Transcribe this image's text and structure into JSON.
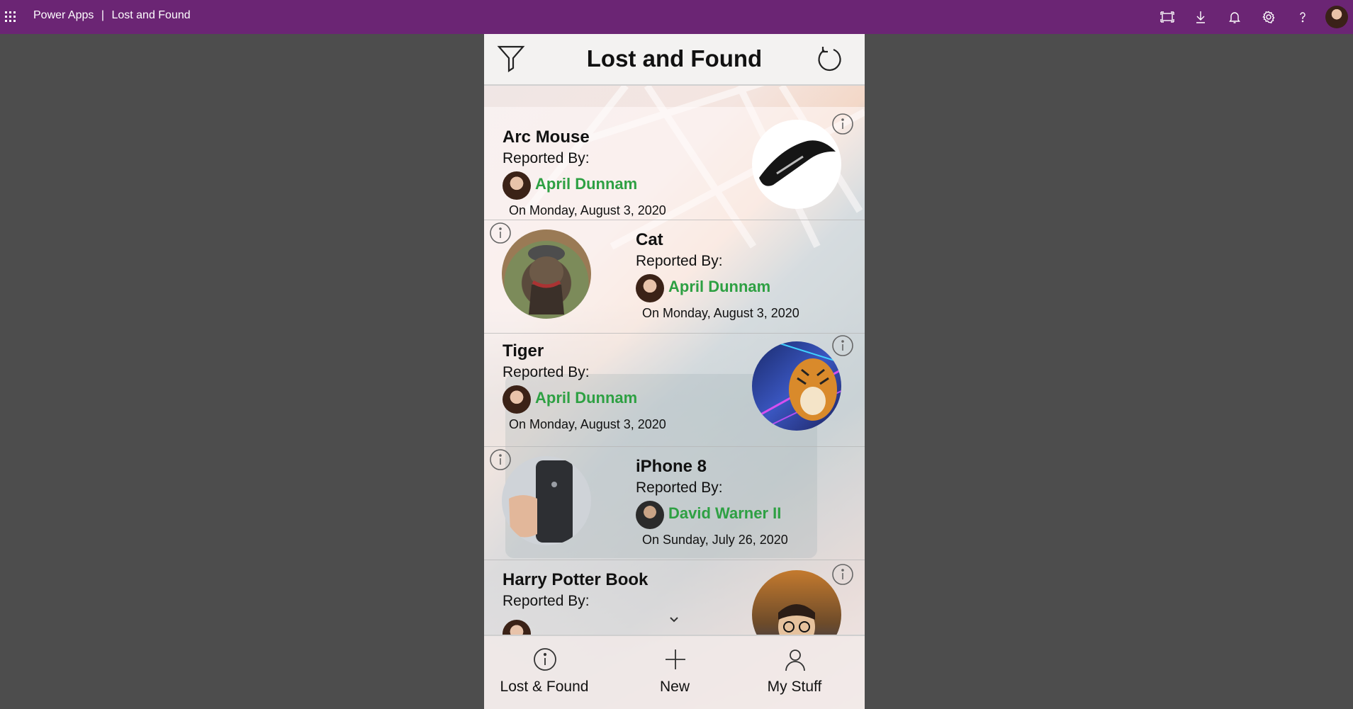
{
  "topbar": {
    "app_name": "Power Apps",
    "separator": "|",
    "app_title": "Lost and Found",
    "icons": [
      "waffle-icon",
      "fit-to-screen-icon",
      "download-icon",
      "bell-icon",
      "gear-icon",
      "help-icon",
      "user-avatar"
    ]
  },
  "header": {
    "title": "Lost and Found",
    "filter_icon": "filter-icon",
    "refresh_icon": "refresh-icon"
  },
  "items": [
    {
      "name": "Arc Mouse",
      "reported_label": "Reported By:",
      "reporter": "April Dunnam",
      "date": "On Monday, August 3, 2020",
      "photo": "arc-mouse"
    },
    {
      "name": "Cat",
      "reported_label": "Reported By:",
      "reporter": "April Dunnam",
      "date": "On Monday, August 3, 2020",
      "photo": "cat"
    },
    {
      "name": "Tiger",
      "reported_label": "Reported By:",
      "reporter": "April Dunnam",
      "date": "On Monday, August 3, 2020",
      "photo": "tiger"
    },
    {
      "name": "iPhone 8",
      "reported_label": "Reported By:",
      "reporter": "David Warner II",
      "date": "On Sunday, July 26, 2020",
      "photo": "iphone"
    },
    {
      "name": "Harry Potter Book",
      "reported_label": "Reported By:",
      "photo": "harry-potter-book"
    }
  ],
  "nav": {
    "lost_found": "Lost & Found",
    "new": "New",
    "my_stuff": "My Stuff"
  },
  "colors": {
    "topbar": "#6b2574",
    "reporter_name": "#2ea043",
    "page_bg": "#4d4d4d"
  }
}
